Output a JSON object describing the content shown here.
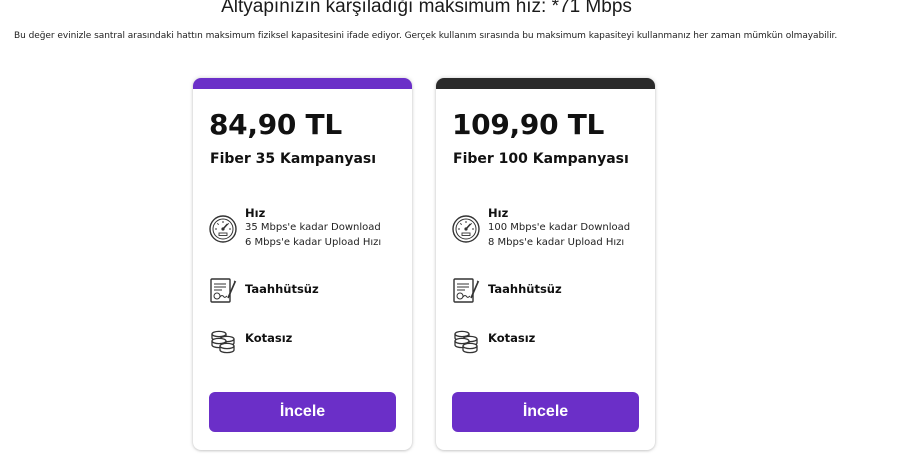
{
  "header": {
    "headline": "Altyapınızın karşıladığı maksimum hız: *71 Mbps",
    "description": "Bu değer evinizle santral arasındaki hattın maksimum fiziksel kapasitesini ifade ediyor. Gerçek kullanım sırasında bu maksimum kapasiteyi kullanmanız her zaman mümkün olmayabilir."
  },
  "colors": {
    "accent": "#6b2fc8",
    "dark_bar": "#2a2a2a"
  },
  "plans": [
    {
      "price": "84,90 TL",
      "name": "Fiber 35 Kampanyası",
      "speed_title": "Hız",
      "download": "35 Mbps'e kadar Download",
      "upload": "6 Mbps'e kadar Upload Hızı",
      "contract": "Taahhütsüz",
      "quota": "Kotasız",
      "button": "İncele"
    },
    {
      "price": "109,90 TL",
      "name": "Fiber 100 Kampanyası",
      "speed_title": "Hız",
      "download": "100 Mbps'e kadar Download",
      "upload": "8 Mbps'e kadar Upload Hızı",
      "contract": "Taahhütsüz",
      "quota": "Kotasız",
      "button": "İncele"
    }
  ],
  "icons": {
    "speed": "speedometer-icon",
    "contract": "contract-document-icon",
    "quota": "database-stack-icon"
  }
}
